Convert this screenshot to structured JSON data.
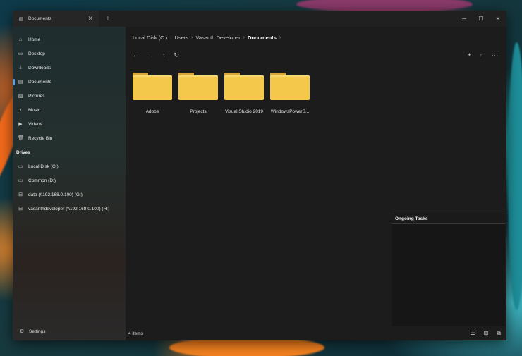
{
  "window": {
    "tab_title": "Documents",
    "tab_close": "✕",
    "new_tab": "+",
    "controls": {
      "minimize": "─",
      "maximize": "☐",
      "close": "✕"
    }
  },
  "sidebar": {
    "items": [
      {
        "label": "Home",
        "icon": "home-icon"
      },
      {
        "label": "Desktop",
        "icon": "desktop-icon"
      },
      {
        "label": "Downloads",
        "icon": "download-icon"
      },
      {
        "label": "Documents",
        "icon": "document-icon"
      },
      {
        "label": "Pictures",
        "icon": "picture-icon"
      },
      {
        "label": "Music",
        "icon": "music-icon"
      },
      {
        "label": "Videos",
        "icon": "video-icon"
      },
      {
        "label": "Recycle Bin",
        "icon": "recycle-bin-icon"
      }
    ],
    "drives_header": "Drives",
    "drives": [
      {
        "label": "Local Disk (C:)",
        "icon": "drive-icon"
      },
      {
        "label": "Common (D:)",
        "icon": "drive-icon"
      },
      {
        "label": "data (\\\\192.168.0.100) (G:)",
        "icon": "network-drive-icon"
      },
      {
        "label": "vasanthdeveloper (\\\\192.168.0.100) (H:)",
        "icon": "network-drive-icon"
      }
    ],
    "settings_label": "Settings"
  },
  "breadcrumb": {
    "parts": [
      "Local Disk (C:)",
      "Users",
      "Vasanth Developer",
      "Documents"
    ],
    "separator": "›"
  },
  "toolbar": {
    "back": "←",
    "forward": "→",
    "up": "↑",
    "refresh": "↻",
    "new": "+",
    "search": "⌕",
    "more": "···"
  },
  "files": [
    {
      "name": "Adobe"
    },
    {
      "name": "Projects"
    },
    {
      "name": "Visual Studio 2019"
    },
    {
      "name": "WindowsPowerS..."
    }
  ],
  "ongoing_tasks": {
    "title": "Ongoing Tasks"
  },
  "status": {
    "item_count": "4 items"
  },
  "colors": {
    "accent": "#4aa3ff",
    "folder": "#f4c84a",
    "window_bg": "#1c1c1c"
  }
}
